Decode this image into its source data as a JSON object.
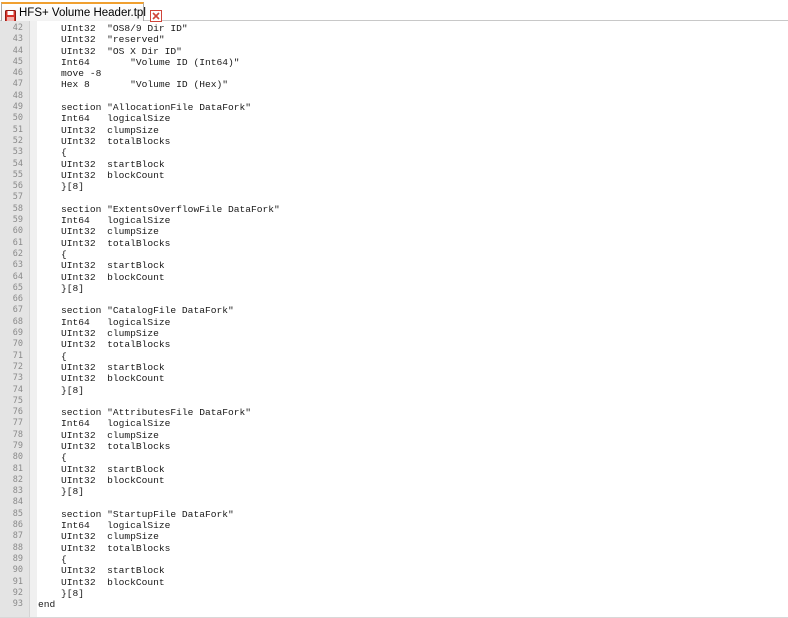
{
  "tab": {
    "title": "HFS+ Volume Header.tpl",
    "icon": "floppy-disk-icon",
    "close_icon": "close-icon",
    "accent": "#f0a030"
  },
  "editor": {
    "lines": [
      {
        "n": "42",
        "text": "    UInt32  \"OS8/9 Dir ID\""
      },
      {
        "n": "43",
        "text": "    UInt32  \"reserved\""
      },
      {
        "n": "44",
        "text": "    UInt32  \"OS X Dir ID\""
      },
      {
        "n": "45",
        "text": "    Int64       \"Volume ID (Int64)\""
      },
      {
        "n": "46",
        "text": "    move -8"
      },
      {
        "n": "47",
        "text": "    Hex 8       \"Volume ID (Hex)\""
      },
      {
        "n": "48",
        "text": ""
      },
      {
        "n": "49",
        "text": "    section \"AllocationFile DataFork\""
      },
      {
        "n": "50",
        "text": "    Int64   logicalSize"
      },
      {
        "n": "51",
        "text": "    UInt32  clumpSize"
      },
      {
        "n": "52",
        "text": "    UInt32  totalBlocks"
      },
      {
        "n": "53",
        "text": "    {"
      },
      {
        "n": "54",
        "text": "    UInt32  startBlock"
      },
      {
        "n": "55",
        "text": "    UInt32  blockCount"
      },
      {
        "n": "56",
        "text": "    }[8]"
      },
      {
        "n": "57",
        "text": ""
      },
      {
        "n": "58",
        "text": "    section \"ExtentsOverflowFile DataFork\""
      },
      {
        "n": "59",
        "text": "    Int64   logicalSize"
      },
      {
        "n": "60",
        "text": "    UInt32  clumpSize"
      },
      {
        "n": "61",
        "text": "    UInt32  totalBlocks"
      },
      {
        "n": "62",
        "text": "    {"
      },
      {
        "n": "63",
        "text": "    UInt32  startBlock"
      },
      {
        "n": "64",
        "text": "    UInt32  blockCount"
      },
      {
        "n": "65",
        "text": "    }[8]"
      },
      {
        "n": "66",
        "text": ""
      },
      {
        "n": "67",
        "text": "    section \"CatalogFile DataFork\""
      },
      {
        "n": "68",
        "text": "    Int64   logicalSize"
      },
      {
        "n": "69",
        "text": "    UInt32  clumpSize"
      },
      {
        "n": "70",
        "text": "    UInt32  totalBlocks"
      },
      {
        "n": "71",
        "text": "    {"
      },
      {
        "n": "72",
        "text": "    UInt32  startBlock"
      },
      {
        "n": "73",
        "text": "    UInt32  blockCount"
      },
      {
        "n": "74",
        "text": "    }[8]"
      },
      {
        "n": "75",
        "text": ""
      },
      {
        "n": "76",
        "text": "    section \"AttributesFile DataFork\""
      },
      {
        "n": "77",
        "text": "    Int64   logicalSize"
      },
      {
        "n": "78",
        "text": "    UInt32  clumpSize"
      },
      {
        "n": "79",
        "text": "    UInt32  totalBlocks"
      },
      {
        "n": "80",
        "text": "    {"
      },
      {
        "n": "81",
        "text": "    UInt32  startBlock"
      },
      {
        "n": "82",
        "text": "    UInt32  blockCount"
      },
      {
        "n": "83",
        "text": "    }[8]"
      },
      {
        "n": "84",
        "text": ""
      },
      {
        "n": "85",
        "text": "    section \"StartupFile DataFork\""
      },
      {
        "n": "86",
        "text": "    Int64   logicalSize"
      },
      {
        "n": "87",
        "text": "    UInt32  clumpSize"
      },
      {
        "n": "88",
        "text": "    UInt32  totalBlocks"
      },
      {
        "n": "89",
        "text": "    {"
      },
      {
        "n": "90",
        "text": "    UInt32  startBlock"
      },
      {
        "n": "91",
        "text": "    UInt32  blockCount"
      },
      {
        "n": "92",
        "text": "    }[8]"
      },
      {
        "n": "93",
        "text": "end"
      }
    ]
  }
}
